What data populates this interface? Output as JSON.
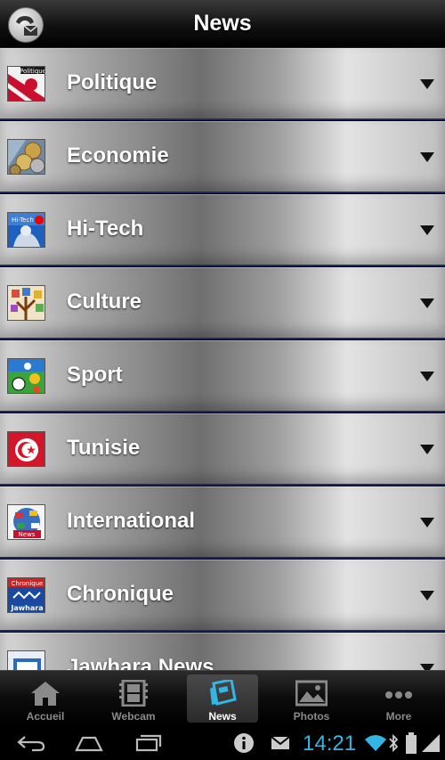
{
  "header": {
    "title": "News",
    "contact_icon": "phone-mail-icon"
  },
  "categories": [
    {
      "label": "Politique",
      "icon": "politique-thumbnail"
    },
    {
      "label": "Economie",
      "icon": "economie-thumbnail"
    },
    {
      "label": "Hi-Tech",
      "icon": "hitech-thumbnail"
    },
    {
      "label": "Culture",
      "icon": "culture-thumbnail"
    },
    {
      "label": "Sport",
      "icon": "sport-thumbnail"
    },
    {
      "label": "Tunisie",
      "icon": "tunisie-flag-thumbnail"
    },
    {
      "label": "International",
      "icon": "international-thumbnail"
    },
    {
      "label": "Chronique",
      "icon": "chronique-thumbnail"
    },
    {
      "label": "Jawhara News",
      "icon": "jawhara-news-thumbnail"
    }
  ],
  "thumb_texts": {
    "politique": "Politique",
    "hitech": "Hi-Tech",
    "international": "News",
    "chronique_top": "Chronique",
    "chronique_bottom": "Jawhara"
  },
  "tabs": [
    {
      "label": "Accueil",
      "icon": "home-icon",
      "active": false
    },
    {
      "label": "Webcam",
      "icon": "film-icon",
      "active": false
    },
    {
      "label": "News",
      "icon": "news-icon",
      "active": true
    },
    {
      "label": "Photos",
      "icon": "photos-icon",
      "active": false
    },
    {
      "label": "More",
      "icon": "more-dots-icon",
      "active": false
    }
  ],
  "system": {
    "time": "14:21"
  },
  "colors": {
    "accent": "#33b5e5",
    "row_divider": "#1e2a5a"
  }
}
